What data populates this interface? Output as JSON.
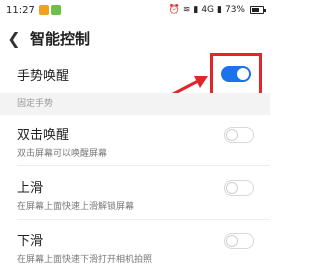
{
  "status_bar": {
    "time": "11:27",
    "network": "4G",
    "battery_percent": "73%",
    "battery_level": 0.73
  },
  "header": {
    "back_icon": "chevron-left-icon",
    "title": "智能控制"
  },
  "gesture_wake": {
    "label": "手势唤醒",
    "enabled": true
  },
  "section": {
    "title": "固定手势"
  },
  "items": [
    {
      "label": "双击唤醒",
      "sub": "双击屏幕可以唤醒屏幕",
      "enabled": false
    },
    {
      "label": "上滑",
      "sub": "在屏幕上面快速上滑解锁屏幕",
      "enabled": false
    },
    {
      "label": "下滑",
      "sub": "在屏幕上面快速下滑打开相机拍照",
      "enabled": false
    }
  ],
  "colors": {
    "toggle_on": "#1a73e8",
    "highlight": "#e0262b"
  }
}
